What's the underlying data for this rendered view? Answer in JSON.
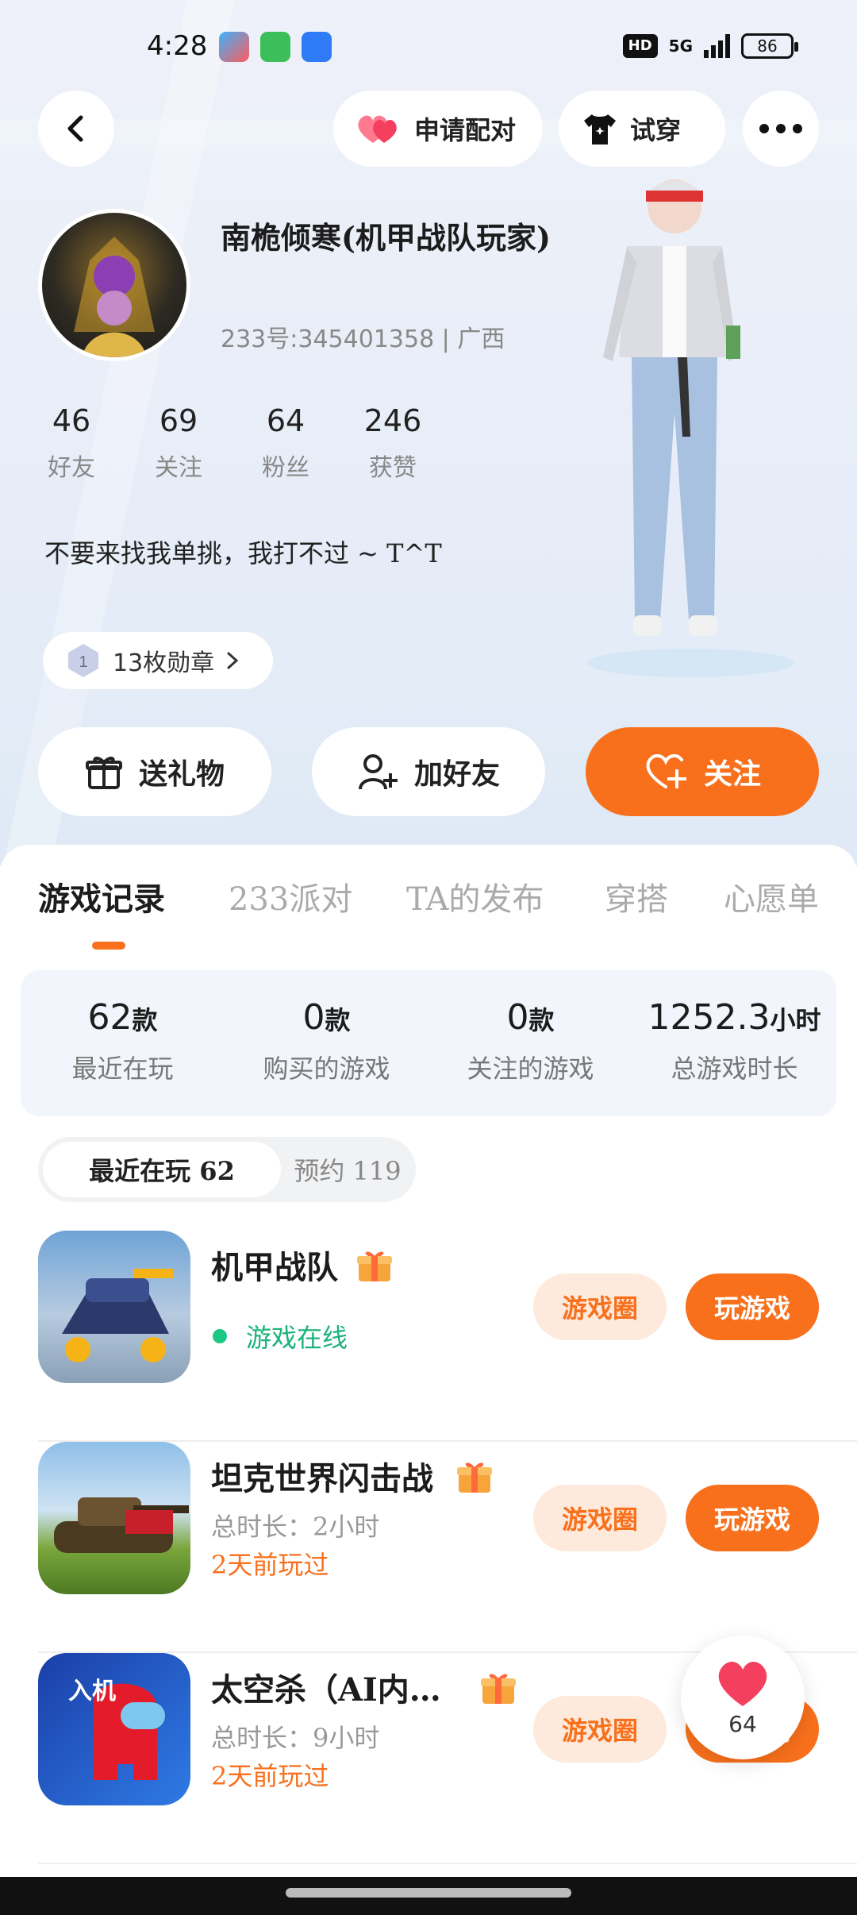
{
  "status_bar": {
    "time": "4:28",
    "network": "5G",
    "hd": "HD",
    "battery": "86"
  },
  "top_bar": {
    "match_label": "申请配对",
    "try_on_label": "试穿"
  },
  "profile": {
    "name": "南桅倾寒(机甲战队玩家)",
    "uid_region": "233号:345401358 | 广西",
    "stats": [
      {
        "value": "46",
        "label": "好友"
      },
      {
        "value": "69",
        "label": "关注"
      },
      {
        "value": "64",
        "label": "粉丝"
      },
      {
        "value": "246",
        "label": "获赞"
      }
    ],
    "bio": "不要来找我单挑，我打不过 ~ T^T",
    "medals": "13枚勋章"
  },
  "actions": {
    "gift": "送礼物",
    "add_friend": "加好友",
    "follow": "关注"
  },
  "tabs": [
    "游戏记录",
    "233派对",
    "TA的发布",
    "穿搭",
    "心愿单"
  ],
  "summary": [
    {
      "value": "62",
      "unit": "款",
      "label": "最近在玩"
    },
    {
      "value": "0",
      "unit": "款",
      "label": "购买的游戏"
    },
    {
      "value": "0",
      "unit": "款",
      "label": "关注的游戏"
    },
    {
      "value": "1252.3",
      "unit": "小时",
      "label": "总游戏时长"
    }
  ],
  "filters": {
    "recent": "最近在玩 62",
    "reserve": "预约 119"
  },
  "games": [
    {
      "title": "机甲战队",
      "line1": "游戏在线",
      "line2": "",
      "circle": "游戏圈",
      "play": "玩游戏"
    },
    {
      "title": "坦克世界闪击战",
      "line1": "总时长：2小时",
      "line2": "2天前玩过",
      "circle": "游戏圈",
      "play": "玩游戏"
    },
    {
      "title": "太空杀（AI内…",
      "line1": "总时长：9小时",
      "line2": "2天前玩过",
      "circle": "游戏圈",
      "play": "玩游戏"
    }
  ],
  "float_like": {
    "count": "64"
  },
  "colors": {
    "accent": "#f8701c",
    "online": "#1bb37b",
    "heart": "#f43f5e"
  }
}
